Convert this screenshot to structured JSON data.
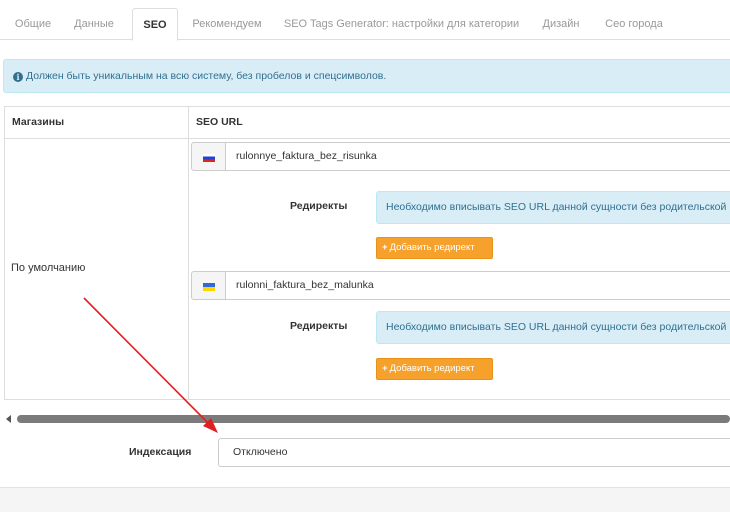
{
  "tabs": [
    {
      "label": "Общие",
      "active": false
    },
    {
      "label": "Данные",
      "active": false
    },
    {
      "label": "SEO",
      "active": true
    },
    {
      "label": "Рекомендуем",
      "active": false
    },
    {
      "label": "SEO Tags Generator: настройки для категории",
      "active": false
    },
    {
      "label": "Дизайн",
      "active": false
    },
    {
      "label": "Сео города",
      "active": false
    }
  ],
  "notice": {
    "icon": "info-circle-icon",
    "text": "Должен быть уникальным на всю систему, без пробелов и спецсимволов."
  },
  "table": {
    "headers": [
      "Магазины",
      "SEO URL"
    ],
    "store_name": "По умолчанию",
    "languages": [
      {
        "flag": "flag-ru-icon",
        "seo_url": "rulonnye_faktura_bez_risunka",
        "redirects_label": "Редиректы",
        "redirects_notice": "Необходимо вписывать SEO URL данной сущности без родительской",
        "add_redirect_label": "Добавить редирект"
      },
      {
        "flag": "flag-ua-icon",
        "seo_url": "rulonni_faktura_bez_malunka",
        "redirects_label": "Редиректы",
        "redirects_notice": "Необходимо вписывать SEO URL данной сущности без родительской",
        "add_redirect_label": "Добавить редирект"
      }
    ]
  },
  "indexing": {
    "label": "Индексация",
    "value": "Отключено"
  },
  "colors": {
    "info_bg": "#d9edf7",
    "info_text": "#31708f",
    "add_button": "#f6a12b",
    "arrow": "#e02020"
  }
}
